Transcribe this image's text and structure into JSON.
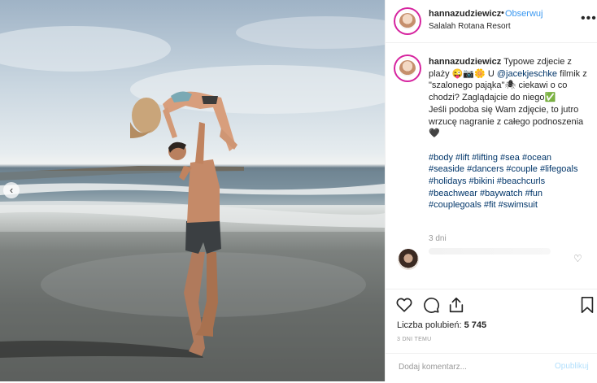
{
  "header": {
    "username": "hannazudziewicz",
    "separator": "•",
    "follow_label": "Obserwuj",
    "location": "Salalah Rotana Resort",
    "more_label": "•••"
  },
  "caption": {
    "username": "hannazudziewicz",
    "text_1": " Typowe zdjecie z plaży 😜📷🌼 U ",
    "mention": "@jacekjeschke",
    "text_2": " filmik z \"szalonego pająka\"🕷 ciekawi o co chodzi? Zaglądajcie do niego✅\nJeśli podoba się Wam zdjęcie, to jutro wrzucę nagranie z całego podnoszenia🖤\n\n",
    "hashtags": "#body #lift #lifting #sea #ocean #seaside #dancers #couple #lifegoals #holidays #bikini #beachcurls #beachwear #baywatch #fun #couplegoals #fit #swimsuit",
    "time": "3 dni"
  },
  "actions": {
    "likes_label": "Liczba polubień:",
    "likes_count": "5 745",
    "posted": "3 DNI TEMU"
  },
  "comment_box": {
    "placeholder": "Dodaj komentarz...",
    "publish_label": "Opublikuj"
  },
  "icons": {
    "like": "heart-icon",
    "comment": "comment-icon",
    "share": "share-icon",
    "save": "bookmark-icon",
    "prev": "chevron-left-icon"
  },
  "colors": {
    "link": "#3897f0",
    "hashtag": "#003569",
    "muted": "#999999",
    "publish_disabled": "#b2dffc"
  }
}
